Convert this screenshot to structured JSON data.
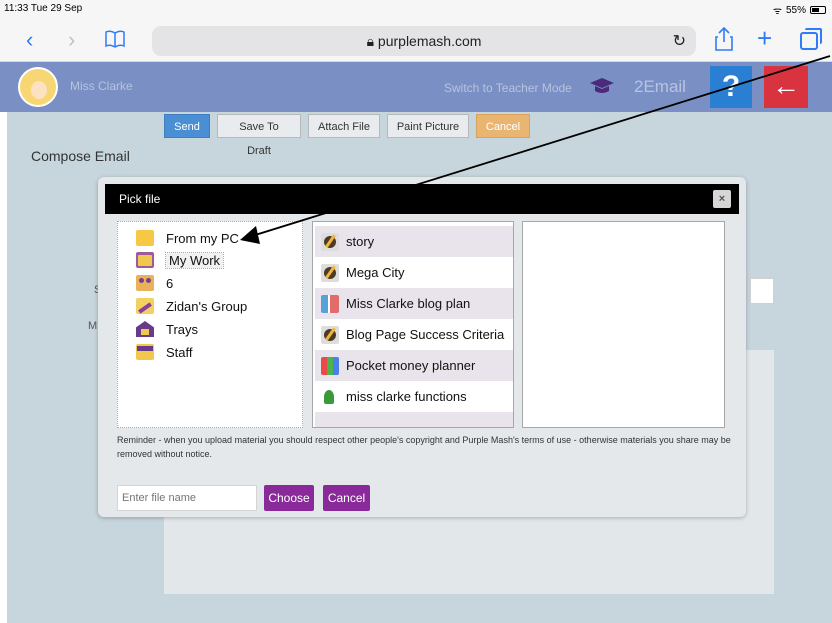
{
  "status_bar": {
    "time": "11:33  Tue 29 Sep",
    "battery": "55%"
  },
  "browser": {
    "url": "purplemash.com",
    "back_glyph": "‹",
    "forward_glyph": "›",
    "reload_glyph": "↻"
  },
  "header": {
    "user_name": "Miss Clarke",
    "teacher_mode_label": "Switch to Teacher Mode",
    "app_name": "2Email",
    "help_label": "?",
    "back_label": "←"
  },
  "compose": {
    "title": "Compose Email",
    "toolbar": {
      "send": "Send",
      "save_draft": "Save To Draft",
      "attach_file": "Attach File",
      "paint_picture": "Paint Picture",
      "cancel": "Cancel"
    },
    "hidden_label_s": "S",
    "hidden_label_m": "M"
  },
  "dialog": {
    "title": "Pick file",
    "close": "×",
    "folders": [
      {
        "label": "From my PC",
        "icon": "folder-icon"
      },
      {
        "label": "My Work",
        "icon": "my-work-folder-icon",
        "selected": true
      },
      {
        "label": "6",
        "icon": "class-group-icon"
      },
      {
        "label": "Zidan's Group",
        "icon": "group-icon"
      },
      {
        "label": "Trays",
        "icon": "trays-icon"
      },
      {
        "label": "Staff",
        "icon": "staff-icon"
      }
    ],
    "files": [
      {
        "label": "story",
        "icon": "write-icon"
      },
      {
        "label": "Mega City",
        "icon": "write-icon"
      },
      {
        "label": "Miss Clarke blog plan",
        "icon": "blog-icon"
      },
      {
        "label": "Blog Page Success Criteria",
        "icon": "write-icon"
      },
      {
        "label": "Pocket money planner",
        "icon": "spreadsheet-icon"
      },
      {
        "label": "miss clarke functions",
        "icon": "code-icon"
      }
    ],
    "reminder": "Reminder - when you upload material you should respect other people's copyright and Purple Mash's terms of use - otherwise materials you share may be removed without notice.",
    "filename_placeholder": "Enter file name",
    "choose": "Choose",
    "cancel": "Cancel"
  }
}
